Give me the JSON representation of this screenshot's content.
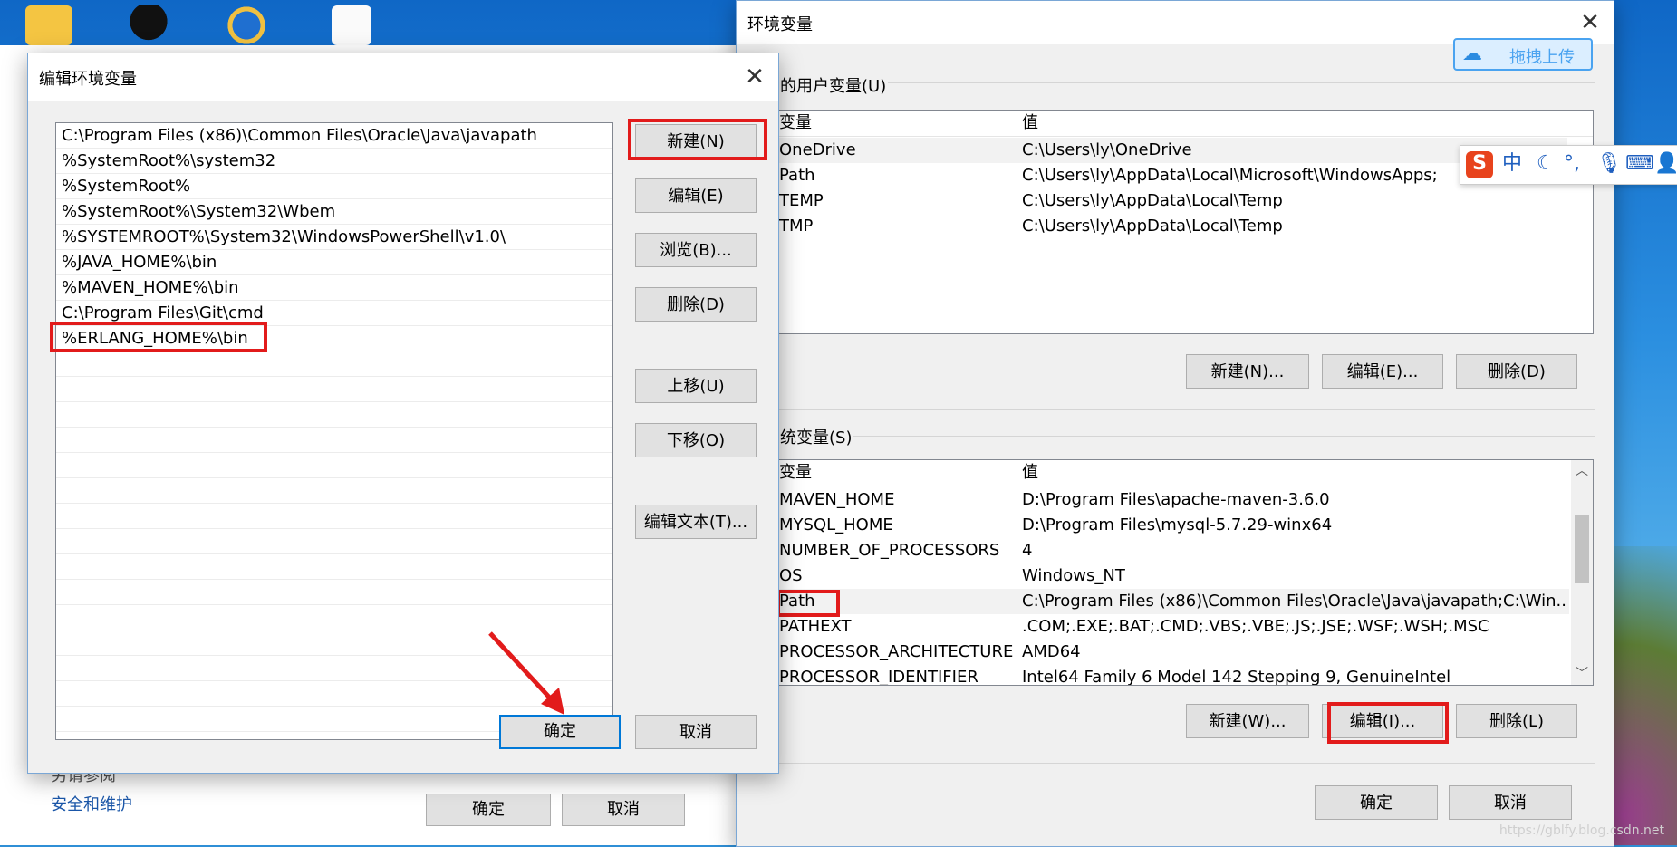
{
  "edit_dialog": {
    "title": "编辑环境变量",
    "close_glyph": "✕",
    "paths": [
      "C:\\Program Files (x86)\\Common Files\\Oracle\\Java\\javapath",
      "%SystemRoot%\\system32",
      "%SystemRoot%",
      "%SystemRoot%\\System32\\Wbem",
      "%SYSTEMROOT%\\System32\\WindowsPowerShell\\v1.0\\",
      "%JAVA_HOME%\\bin",
      "%MAVEN_HOME%\\bin",
      "C:\\Program Files\\Git\\cmd",
      "%ERLANG_HOME%\\bin"
    ],
    "buttons": {
      "new": "新建(N)",
      "edit": "编辑(E)",
      "browse": "浏览(B)...",
      "delete": "删除(D)",
      "move_up": "上移(U)",
      "move_down": "下移(O)",
      "edit_text": "编辑文本(T)...",
      "ok": "确定",
      "cancel": "取消"
    }
  },
  "env_dialog": {
    "title": "环境变量",
    "close_glyph": "✕",
    "user_group_label": "的用户变量(U)",
    "system_group_label": "统变量(S)",
    "col_variable": "变量",
    "col_value": "值",
    "user_vars": [
      {
        "name": "OneDrive",
        "value": "C:\\Users\\ly\\OneDrive"
      },
      {
        "name": "Path",
        "value": "C:\\Users\\ly\\AppData\\Local\\Microsoft\\WindowsApps;"
      },
      {
        "name": "TEMP",
        "value": "C:\\Users\\ly\\AppData\\Local\\Temp"
      },
      {
        "name": "TMP",
        "value": "C:\\Users\\ly\\AppData\\Local\\Temp"
      }
    ],
    "system_vars": [
      {
        "name": "MAVEN_HOME",
        "value": "D:\\Program Files\\apache-maven-3.6.0"
      },
      {
        "name": "MYSQL_HOME",
        "value": "D:\\Program Files\\mysql-5.7.29-winx64"
      },
      {
        "name": "NUMBER_OF_PROCESSORS",
        "value": "4"
      },
      {
        "name": "OS",
        "value": "Windows_NT"
      },
      {
        "name": "Path",
        "value": "C:\\Program Files (x86)\\Common Files\\Oracle\\Java\\javapath;C:\\Win..."
      },
      {
        "name": "PATHEXT",
        "value": ".COM;.EXE;.BAT;.CMD;.VBS;.VBE;.JS;.JSE;.WSF;.WSH;.MSC"
      },
      {
        "name": "PROCESSOR_ARCHITECTURE",
        "value": "AMD64"
      },
      {
        "name": "PROCESSOR_IDENTIFIER",
        "value": "Intel64 Family 6 Model 142 Stepping 9, GenuineIntel"
      }
    ],
    "user_buttons": {
      "new": "新建(N)...",
      "edit": "编辑(E)...",
      "delete": "删除(D)"
    },
    "system_buttons": {
      "new": "新建(W)...",
      "edit": "编辑(I)...",
      "delete": "删除(L)"
    },
    "ok": "确定",
    "cancel": "取消",
    "upload_label": "拖拽上传"
  },
  "back_window": {
    "link_partial": "另请参阅",
    "link_security": "安全和维护",
    "btn_ok_partial": "确定",
    "btn_cancel_partial": "取消"
  },
  "ime": {
    "lang": "中",
    "logo": "S"
  },
  "watermark": "https://gblfy.blog.csdn.net",
  "colors": {
    "highlight": "#e21b1b",
    "accent": "#0078d7",
    "arrow": "#e21b1b"
  }
}
